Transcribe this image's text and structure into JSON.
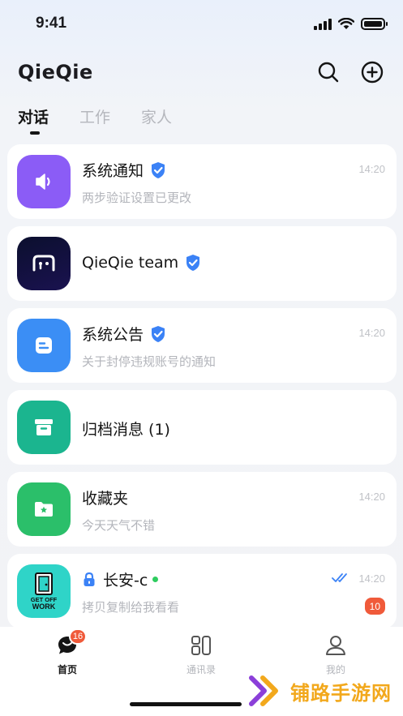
{
  "status_bar": {
    "time": "9:41"
  },
  "header": {
    "title": "QieQie",
    "search_icon": "search-icon",
    "add_icon": "plus-circle-icon"
  },
  "tabs": [
    {
      "label": "对话",
      "active": true
    },
    {
      "label": "工作",
      "active": false
    },
    {
      "label": "家人",
      "active": false
    }
  ],
  "chats": [
    {
      "name": "系统通知",
      "preview": "两步验证设置已更改",
      "time": "14:20",
      "verified": true,
      "avatar_color": "#8b5cf6",
      "avatar_icon": "speaker-icon"
    },
    {
      "name": "QieQie team",
      "preview": "",
      "time": "",
      "verified": true,
      "avatar_color": "#0b0f2e",
      "avatar_icon": "qieqie-logo-icon"
    },
    {
      "name": "系统公告",
      "preview": "关于封停违规账号的通知",
      "time": "14:20",
      "verified": true,
      "avatar_color": "#3b8ef5",
      "avatar_icon": "announcement-icon"
    },
    {
      "name": "归档消息 (1)",
      "preview": "",
      "time": "",
      "verified": false,
      "avatar_color": "#1bb58f",
      "avatar_icon": "archive-box-icon"
    },
    {
      "name": "收藏夹",
      "preview": "今天天气不错",
      "time": "14:20",
      "verified": false,
      "avatar_color": "#2bbf6a",
      "avatar_icon": "folder-star-icon"
    },
    {
      "name": "长安-c",
      "preview": "拷贝复制给我看看",
      "time": "14:20",
      "verified": false,
      "locked": true,
      "online": true,
      "read": true,
      "unread": "10",
      "avatar_color": "#2fd4c8",
      "avatar_icon": "get-off-work-sticker-icon",
      "avatar_text": "GET OFF WORK"
    }
  ],
  "tab_bar": [
    {
      "label": "首页",
      "icon": "chat-bubble-icon",
      "active": true,
      "badge": "16"
    },
    {
      "label": "通讯录",
      "icon": "contacts-grid-icon",
      "active": false
    },
    {
      "label": "我的",
      "icon": "user-icon",
      "active": false
    }
  ],
  "watermark": {
    "text": "铺路手游网"
  },
  "colors": {
    "accent_verified": "#3b82f6",
    "badge": "#f05a3a",
    "online": "#2ecc5f",
    "watermark": "#f2a81c"
  }
}
